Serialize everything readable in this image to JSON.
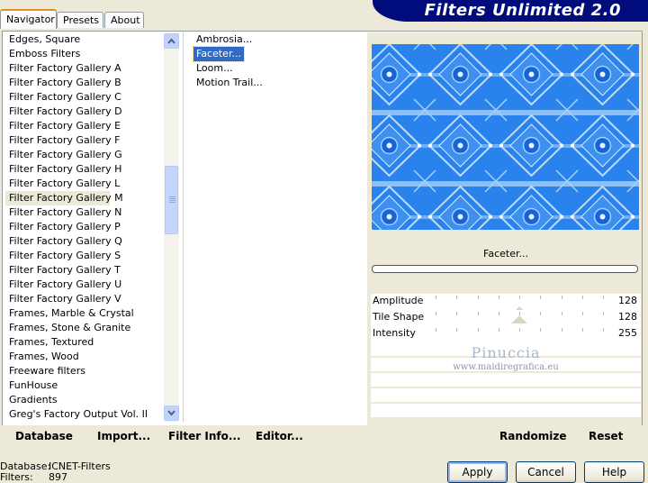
{
  "tabs": [
    "Navigator",
    "Presets",
    "About"
  ],
  "header": {
    "title": "Filters Unlimited 2.0"
  },
  "categories": [
    "Edges, Square",
    "Emboss Filters",
    "Filter Factory Gallery A",
    "Filter Factory Gallery B",
    "Filter Factory Gallery C",
    "Filter Factory Gallery D",
    "Filter Factory Gallery E",
    "Filter Factory Gallery F",
    "Filter Factory Gallery G",
    "Filter Factory Gallery H",
    "Filter Factory Gallery L",
    "Filter Factory Gallery M",
    "Filter Factory Gallery N",
    "Filter Factory Gallery P",
    "Filter Factory Gallery Q",
    "Filter Factory Gallery S",
    "Filter Factory Gallery T",
    "Filter Factory Gallery U",
    "Filter Factory Gallery V",
    "Frames, Marble & Crystal",
    "Frames, Stone & Granite",
    "Frames, Textured",
    "Frames, Wood",
    "Freeware filters",
    "FunHouse",
    "Gradients",
    "Greg's Factory Output Vol. II"
  ],
  "selected_category": "Filter Factory Gallery M",
  "filters": [
    "Ambrosia...",
    "Faceter...",
    "Loom...",
    "Motion Trail..."
  ],
  "selected_filter": "Faceter...",
  "current_filter_label": "Faceter...",
  "params": [
    {
      "label": "Amplitude",
      "value": "128",
      "level": 0.5
    },
    {
      "label": "Tile Shape",
      "value": "128",
      "level": 0.5
    },
    {
      "label": "Intensity",
      "value": "255",
      "level": 1.0
    }
  ],
  "watermark": {
    "line1": "Pinuccia",
    "line2": "www.maidiregrafica.eu"
  },
  "toolbar": {
    "database": "Database",
    "import": "Import...",
    "filter_info": "Filter Info...",
    "editor": "Editor...",
    "randomize": "Randomize",
    "reset": "Reset"
  },
  "status": {
    "database_label": "Database:",
    "database_value": "ICNET-Filters",
    "filters_label": "Filters:",
    "filters_value": "897"
  },
  "dialog": {
    "apply": "Apply",
    "cancel": "Cancel",
    "help": "Help"
  },
  "colors": {
    "banner": "#000c7b",
    "preview_blue": "#1f7ae8",
    "selection": "#316ac5",
    "tab_accent": "#e68b2c"
  }
}
